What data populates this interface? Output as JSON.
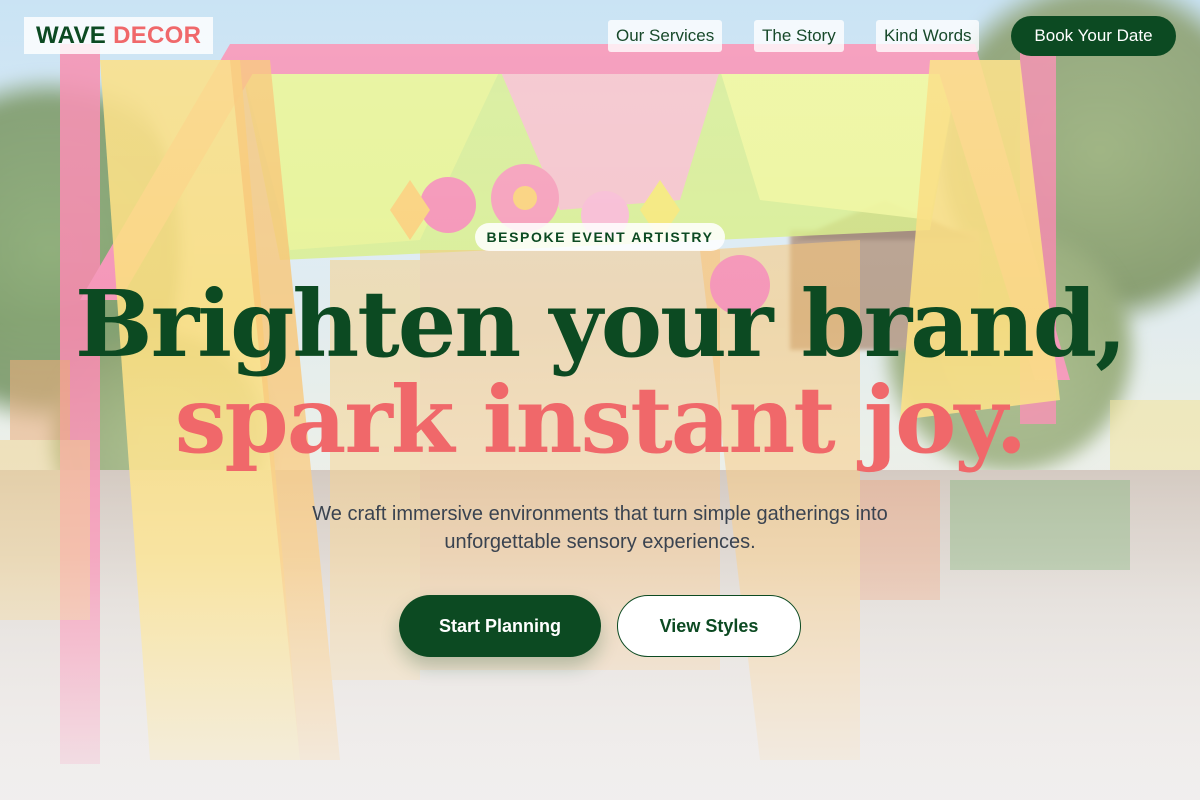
{
  "header": {
    "logo": {
      "word1": "WAVE",
      "word2": "DECOR"
    },
    "nav": [
      {
        "label": "Our Services"
      },
      {
        "label": "The Story"
      },
      {
        "label": "Kind Words"
      }
    ],
    "cta_label": "Book Your Date"
  },
  "hero": {
    "eyebrow": "BESPOKE EVENT ARTISTRY",
    "headline_line1": "Brighten your brand,",
    "headline_line2": "spark instant joy.",
    "subtext_line1": "We craft immersive environments that turn simple gatherings into",
    "subtext_line2": "unforgettable sensory experiences.",
    "primary_button": "Start Planning",
    "secondary_button": "View Styles"
  },
  "colors": {
    "brand_green": "#0c4a22",
    "accent_coral": "#f0686a",
    "body_text": "#3a4350"
  }
}
